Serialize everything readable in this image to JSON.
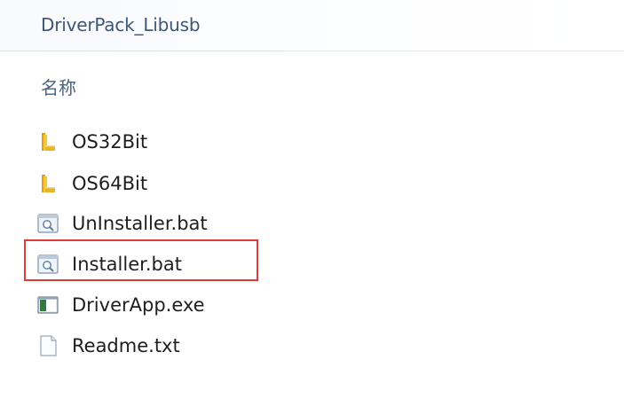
{
  "address_bar": {
    "path": "DriverPack_Libusb"
  },
  "list_header": {
    "name_column": "名称"
  },
  "files": [
    {
      "name": "OS32Bit",
      "icon": "folder-icon"
    },
    {
      "name": "OS64Bit",
      "icon": "folder-icon"
    },
    {
      "name": "UnInstaller.bat",
      "icon": "batch-file-icon"
    },
    {
      "name": "Installer.bat",
      "icon": "batch-file-icon"
    },
    {
      "name": "DriverApp.exe",
      "icon": "executable-icon"
    },
    {
      "name": "Readme.txt",
      "icon": "text-file-icon"
    }
  ],
  "highlight": {
    "target": "Installer.bat",
    "color": "#e23a3a"
  },
  "colors": {
    "folder": "#e8b423",
    "address_text": "#3f5777",
    "header_text": "#4a6282"
  }
}
